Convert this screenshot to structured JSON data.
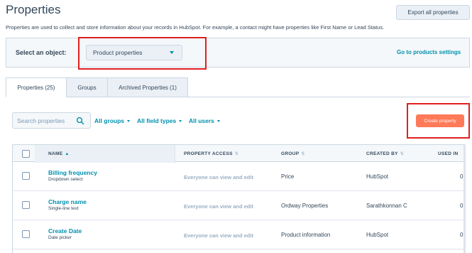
{
  "header": {
    "title": "Properties",
    "export_label": "Export all properties",
    "description": "Properties are used to collect and store information about your records in HubSpot. For example, a contact might have properties like First Name or Lead Status."
  },
  "object_selector": {
    "label": "Select an object:",
    "selected": "Product properties",
    "goto_link": "Go to products settings"
  },
  "tabs": [
    {
      "label": "Properties (25)",
      "active": true
    },
    {
      "label": "Groups",
      "active": false
    },
    {
      "label": "Archived Properties (1)",
      "active": false
    }
  ],
  "filters": {
    "search_placeholder": "Search properties",
    "groups": "All groups",
    "field_types": "All field types",
    "users": "All users"
  },
  "create_button": "Create property",
  "table": {
    "columns": [
      "NAME",
      "PROPERTY ACCESS",
      "GROUP",
      "CREATED BY",
      "USED IN"
    ],
    "rows": [
      {
        "name": "Billing frequency",
        "type": "Dropdown select",
        "access": "Everyone can view and edit",
        "group": "Price",
        "created_by": "HubSpot",
        "used_in": "0"
      },
      {
        "name": "Charge name",
        "type": "Single-line text",
        "access": "Everyone can view and edit",
        "group": "Ordway Properties",
        "created_by": "Sarathkonnan C",
        "used_in": "0"
      },
      {
        "name": "Create Date",
        "type": "Date picker",
        "access": "Everyone can view and edit",
        "group": "Product information",
        "created_by": "HubSpot",
        "used_in": "0"
      }
    ]
  },
  "colors": {
    "accent": "#0091ae",
    "create_button": "#ff7a59",
    "highlight": "#e0201f"
  }
}
